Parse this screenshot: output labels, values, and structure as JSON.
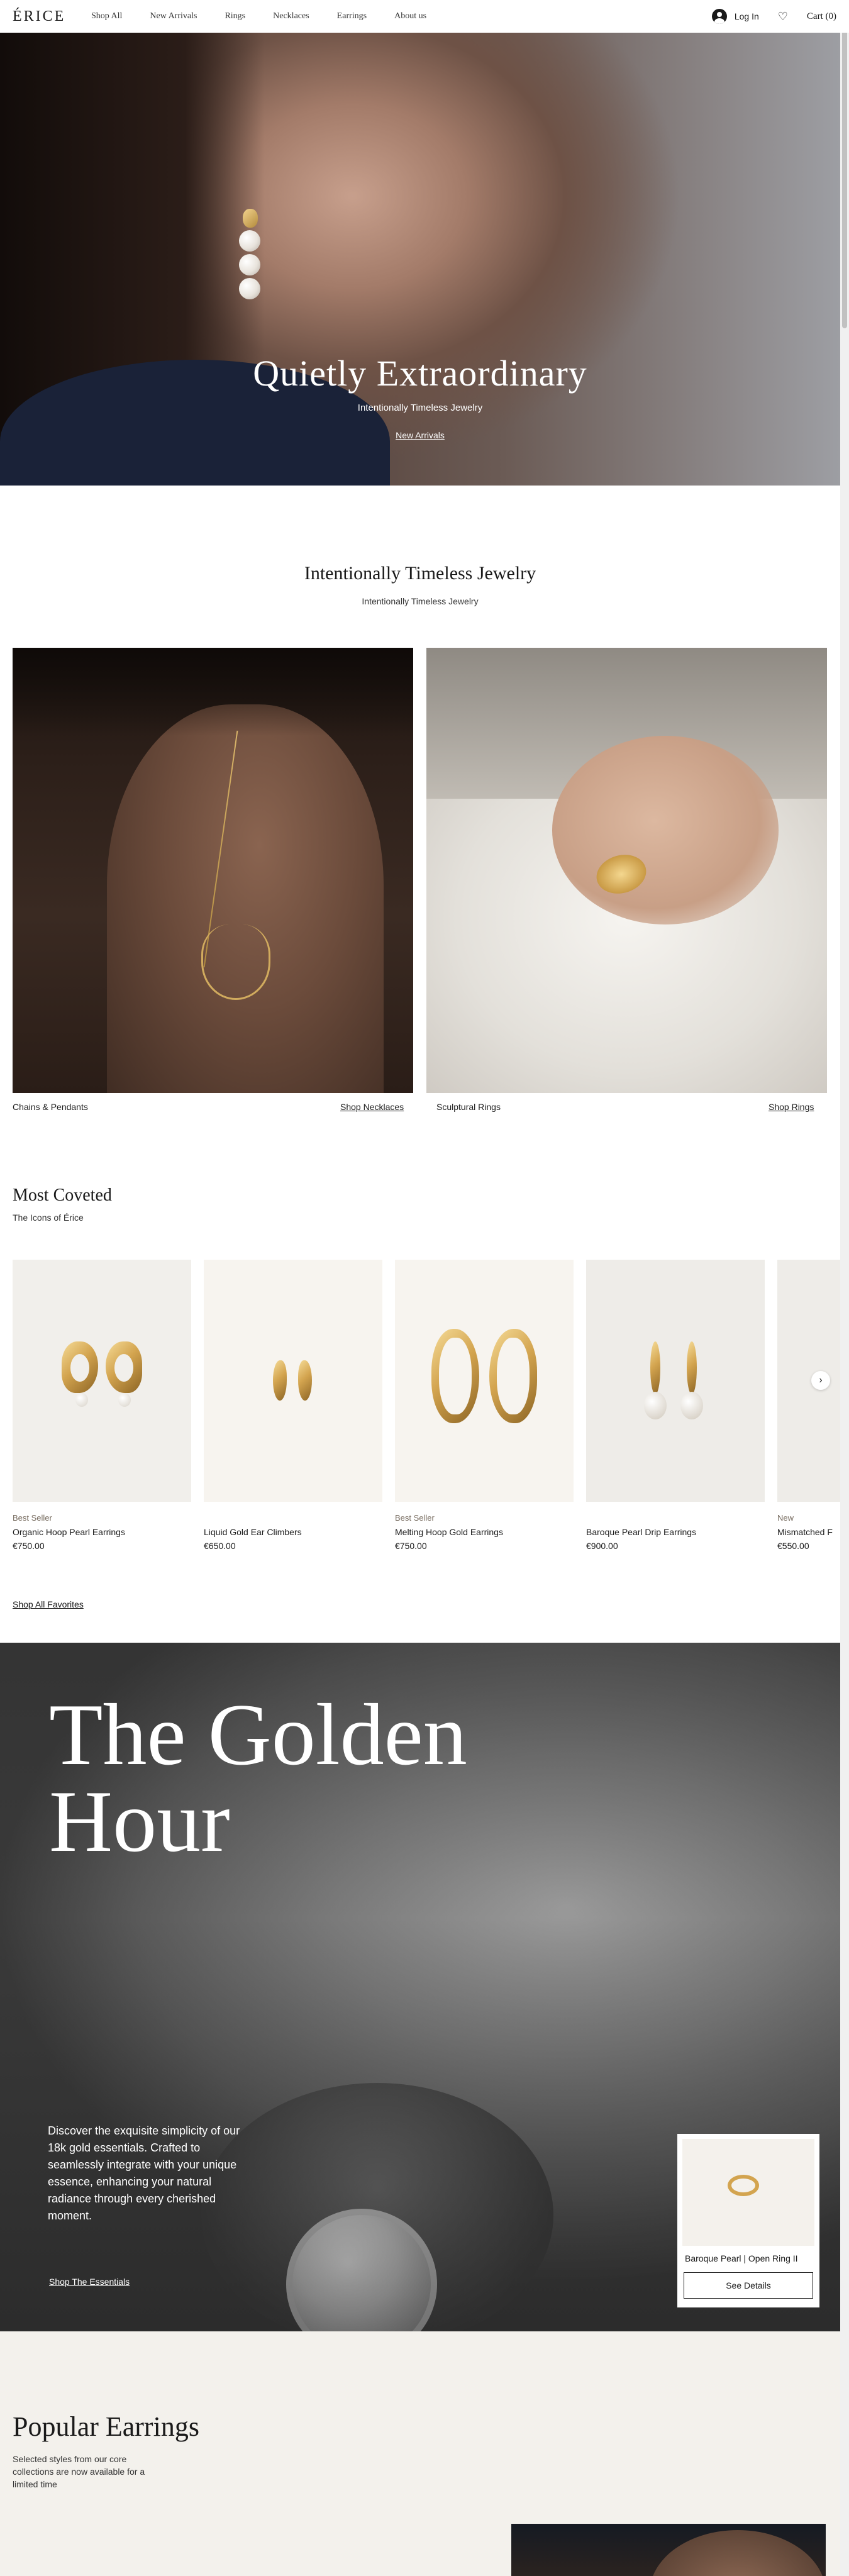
{
  "header": {
    "logo": "ÉRICE",
    "nav": [
      "Shop All",
      "New Arrivals",
      "Rings",
      "Necklaces",
      "Earrings",
      "About us"
    ],
    "login": "Log In",
    "cart": "Cart (0)"
  },
  "hero": {
    "title": "Quietly Extraordinary",
    "subtitle": "Intentionally Timeless Jewelry",
    "link": "New Arrivals"
  },
  "intro": {
    "title": "Intentionally Timeless Jewelry",
    "subtitle": "Intentionally Timeless Jewelry"
  },
  "categories": [
    {
      "label": "Chains & Pendants",
      "link": "Shop Necklaces"
    },
    {
      "label": "Sculptural Rings",
      "link": "Shop Rings"
    }
  ],
  "most_coveted": {
    "title": "Most Coveted",
    "subtitle": "The Icons of Érice",
    "products": [
      {
        "badge": "Best Seller",
        "name": "Organic Hoop Pearl Earrings",
        "price": "€750.00"
      },
      {
        "badge": "",
        "name": "Liquid Gold Ear Climbers",
        "price": "€650.00"
      },
      {
        "badge": "Best Seller",
        "name": "Melting Hoop Gold Earrings",
        "price": "€750.00"
      },
      {
        "badge": "",
        "name": "Baroque Pearl Drip Earrings",
        "price": "€900.00"
      },
      {
        "badge": "New",
        "name": "Mismatched F",
        "price": "€550.00"
      }
    ],
    "next_arrow": "›",
    "shop_all": "Shop All Favorites"
  },
  "golden_hour": {
    "title_line1": "The Golden",
    "title_line2": "Hour",
    "text": "Discover the exquisite simplicity of our 18k gold essentials. Crafted to seamlessly integrate with your unique essence, enhancing your natural radiance through every cherished moment.",
    "link": "Shop The Essentials",
    "card_name": "Baroque Pearl | Open Ring II",
    "card_button": "See Details"
  },
  "popular": {
    "title": "Popular Earrings",
    "text": "Selected styles from our core collections are now available for a limited time"
  },
  "icons": {
    "avatar": "user-avatar-icon",
    "heart": "heart-icon",
    "next": "chevron-right-icon"
  },
  "colors": {
    "gold": "#d3a44f",
    "popular_bg": "#f3f1ec",
    "text": "#1a1a1a"
  }
}
